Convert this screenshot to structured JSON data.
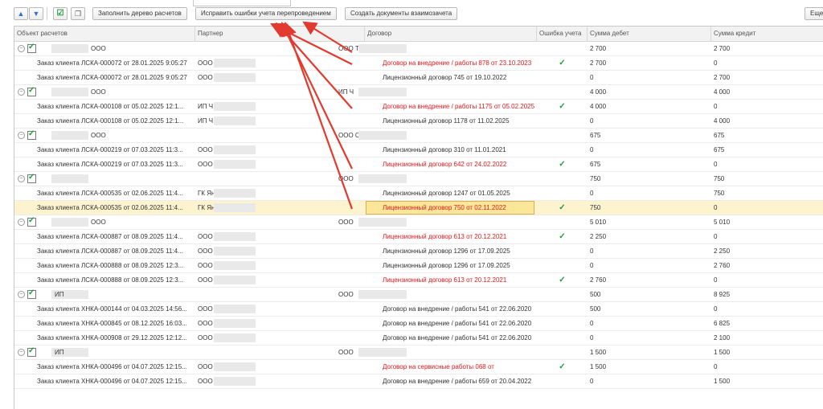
{
  "toolbar": {
    "up_icon": "arrow-up-icon",
    "down_icon": "arrow-down-icon",
    "check_all_icon": "check-all-icon",
    "copy_icon": "copy-icon",
    "fill_tree_label": "Заполнить дерево расчетов",
    "fix_errors_label": "Исправить ошибки учета перепроведением",
    "create_docs_label": "Создать документы взаимозачета",
    "more_label": "Еще"
  },
  "columns": {
    "obj": "Объект расчетов",
    "partner": "Партнер",
    "contract": "Договор",
    "error": "Ошибка учета",
    "debit": "Сумма дебет",
    "credit": "Сумма кредит"
  },
  "rows": [
    {
      "type": "group",
      "name": "ООО",
      "contract": "ООО ТИ",
      "debit": "2 700",
      "credit": "2 700"
    },
    {
      "type": "item",
      "obj": "Заказ клиента ЛСКА-000072 от 28.01.2025 9:05:27",
      "partner": "ООО",
      "contract": "Договор на внедрение / работы 878 от 23.10.2023",
      "error": true,
      "debit": "2 700",
      "credit": "0"
    },
    {
      "type": "item",
      "obj": "Заказ клиента ЛСКА-000072 от 28.01.2025 9:05:27",
      "partner": "ООО",
      "contract": "Лицензионный договор 745 от 19.10.2022",
      "error": false,
      "debit": "0",
      "credit": "2 700"
    },
    {
      "type": "group",
      "name": "ООО",
      "contract": "ИП Ч",
      "debit": "4 000",
      "credit": "4 000"
    },
    {
      "type": "item",
      "obj": "Заказ клиента ЛСКА-000108 от 05.02.2025 12:1...",
      "partner": "ИП Ч                       ргеевна",
      "contract": "Договор на внедрение / работы 1175 от 05.02.2025",
      "error": true,
      "debit": "4 000",
      "credit": "0"
    },
    {
      "type": "item",
      "obj": "Заказ клиента ЛСКА-000108 от 05.02.2025 12:1...",
      "partner": "ИП Ч                       ргеевна",
      "contract": "Лицензионный договор 1178 от 11.02.2025",
      "error": false,
      "debit": "0",
      "credit": "4 000"
    },
    {
      "type": "group",
      "name": "ООО",
      "contract": "ООО С",
      "debit": "675",
      "credit": "675"
    },
    {
      "type": "item",
      "obj": "Заказ клиента ЛСКА-000219 от 07.03.2025 11:3...",
      "partner": "ООО                       ентр",
      "contract": "Лицензионный договор 310 от 11.01.2021",
      "error": false,
      "debit": "0",
      "credit": "675"
    },
    {
      "type": "item",
      "obj": "Заказ клиента ЛСКА-000219 от 07.03.2025 11:3...",
      "partner": "ООО                       ентр",
      "contract": "Лицензионный договор 642 от 24.02.2022",
      "error": true,
      "debit": "675",
      "credit": "0"
    },
    {
      "type": "group",
      "name": "",
      "contract": "ООО",
      "debit": "750",
      "credit": "750"
    },
    {
      "type": "item",
      "obj": "Заказ клиента ЛСКА-000535 от 02.06.2025 11:4...",
      "partner": "ГК Ян",
      "contract": "Лицензионный договор 1247 от 01.05.2025",
      "error": false,
      "debit": "0",
      "credit": "750"
    },
    {
      "type": "item",
      "obj": "Заказ клиента ЛСКА-000535 от 02.06.2025 11:4...",
      "partner": "ГК Ян",
      "contract": "Лицензионный договор 750 от 02.11.2022",
      "error": true,
      "debit": "750",
      "credit": "0",
      "selected": true
    },
    {
      "type": "group",
      "name": "ООО",
      "contract": "ООО",
      "debit": "5 010",
      "credit": "5 010"
    },
    {
      "type": "item",
      "obj": "Заказ клиента ЛСКА-000887 от 08.09.2025 11:4...",
      "partner": "ООО",
      "contract": "Лицензионный договор 613 от 20.12.2021",
      "error": true,
      "debit": "2 250",
      "credit": "0"
    },
    {
      "type": "item",
      "obj": "Заказ клиента ЛСКА-000887 от 08.09.2025 11:4...",
      "partner": "ООО",
      "contract": "Лицензионный договор 1296 от 17.09.2025",
      "error": false,
      "debit": "0",
      "credit": "2 250"
    },
    {
      "type": "item",
      "obj": "Заказ клиента ЛСКА-000888 от 08.09.2025 12:3...",
      "partner": "ООО",
      "contract": "Лицензионный договор 1296 от 17.09.2025",
      "error": false,
      "debit": "0",
      "credit": "2 760"
    },
    {
      "type": "item",
      "obj": "Заказ клиента ЛСКА-000888 от 08.09.2025 12:3...",
      "partner": "ООО",
      "contract": "Лицензионный договор 613 от 20.12.2021",
      "error": true,
      "debit": "2 760",
      "credit": "0"
    },
    {
      "type": "group",
      "name": "ИП",
      "contract": "ООО",
      "debit": "500",
      "credit": "8 925"
    },
    {
      "type": "item",
      "obj": "Заказ клиента ХНКА-000144 от 04.03.2025 14:56...",
      "partner": "ООО",
      "contract": "Договор на внедрение / работы 541 от 22.06.2020",
      "error": false,
      "debit": "500",
      "credit": "0"
    },
    {
      "type": "item",
      "obj": "Заказ клиента ХНКА-000845 от 08.12.2025 16:03...",
      "partner": "ООО",
      "contract": "Договор на внедрение / работы 541 от 22.06.2020",
      "error": false,
      "debit": "0",
      "credit": "6 825"
    },
    {
      "type": "item",
      "obj": "Заказ клиента ХНКА-000908 от 29.12.2025 12:12...",
      "partner": "ООО",
      "contract": "Договор на внедрение / работы 541 от 22.06.2020",
      "error": false,
      "debit": "0",
      "credit": "2 100"
    },
    {
      "type": "group",
      "name": "ИП",
      "contract": "ООО",
      "debit": "1 500",
      "credit": "1 500"
    },
    {
      "type": "item",
      "obj": "Заказ клиента ХНКА-000496 от 04.07.2025 12:15...",
      "partner": "ООО",
      "contract": "Договор на сервисные работы 068 от",
      "error": true,
      "debit": "1 500",
      "credit": "0"
    },
    {
      "type": "item",
      "obj": "Заказ клиента ХНКА-000496 от 04.07.2025 12:15...",
      "partner": "ООО",
      "contract": "Договор на внедрение / работы 659 от 20.04.2022",
      "error": false,
      "debit": "0",
      "credit": "1 500"
    }
  ],
  "colors": {
    "error_text": "#e8151b",
    "check": "#1f9a3a",
    "selected_row": "#fdf3cf",
    "annotation_arrow": "#e23a2e"
  }
}
